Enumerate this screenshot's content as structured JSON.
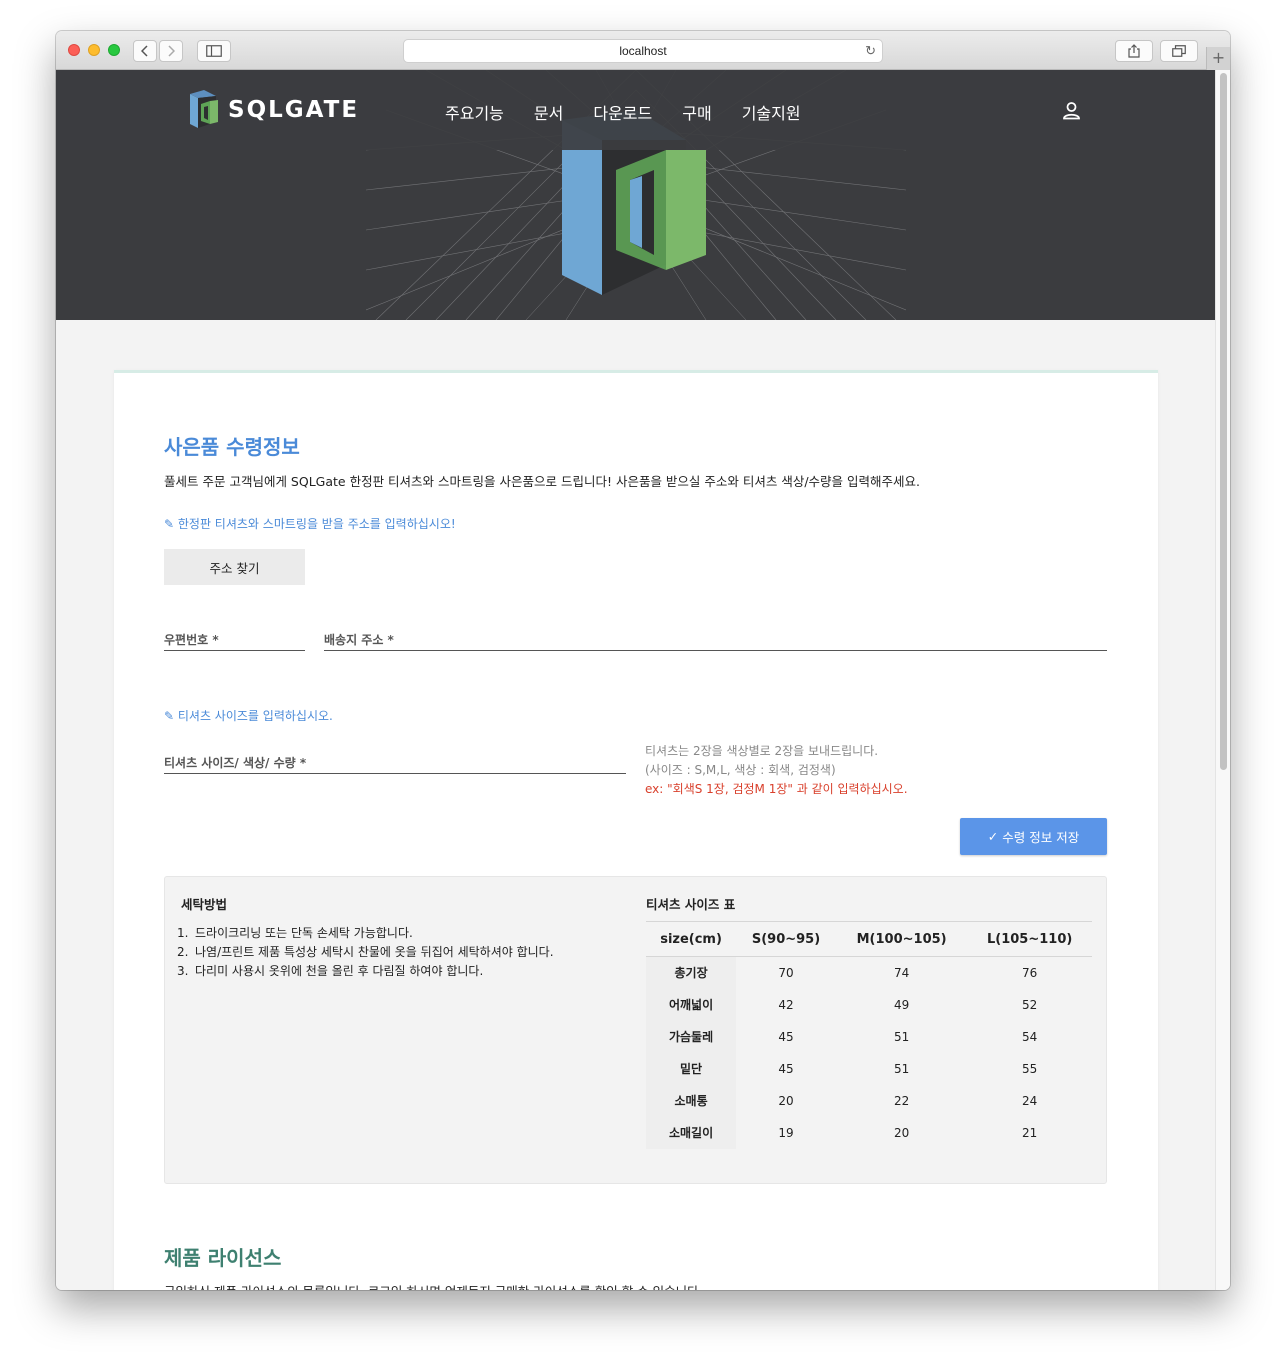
{
  "browser": {
    "url": "localhost"
  },
  "site": {
    "brand": "SQLGATE",
    "nav": [
      "주요기능",
      "문서",
      "다운로드",
      "구매",
      "기술지원"
    ]
  },
  "gift": {
    "title": "사은품 수령정보",
    "description": "풀세트 주문 고객님에게 SQLGate 한정판 티셔츠와 스마트링을 사은품으로 드립니다! 사은품을 받으실 주소와 티셔츠 색상/수량을 입력해주세요.",
    "address_hint": "한정판 티셔츠와 스마트링을 받을 주소를 입력하십시오!",
    "find_address_button": "주소 찾기",
    "postal_code_label": "우편번호 *",
    "address_label": "배송지 주소 *",
    "size_hint": "티셔츠 사이즈를 입력하십시오.",
    "tshirt_label": "티셔츠 사이즈/ 색상/ 수량 *",
    "note_line1": "티셔츠는 2장을 색상별로 2장을 보내드립니다.",
    "note_line2": "(사이즈 : S,M,L, 색상 : 회색, 검정색)",
    "note_example": "ex: \"회색S 1장, 검정M 1장\" 과 같이 입력하십시오.",
    "save_button": "수령 정보 저장"
  },
  "washing": {
    "title": "세탁방법",
    "items": [
      "드라이크리닝 또는 단독 손세탁 가능합니다.",
      "나염/프린트 제품 특성상 세탁시 찬물에 옷을 뒤집어 세탁하셔야 합니다.",
      "다리미 사용시 옷위에 천을 올린 후 다림질 하여야 합니다."
    ]
  },
  "size_chart": {
    "title": "티셔츠 사이즈 표",
    "headers": [
      "size(cm)",
      "S(90~95)",
      "M(100~105)",
      "L(105~110)"
    ],
    "rows": [
      [
        "총기장",
        "70",
        "74",
        "76"
      ],
      [
        "어깨넓이",
        "42",
        "49",
        "52"
      ],
      [
        "가슴둘레",
        "45",
        "51",
        "54"
      ],
      [
        "밑단",
        "45",
        "51",
        "55"
      ],
      [
        "소매통",
        "20",
        "22",
        "24"
      ],
      [
        "소매길이",
        "19",
        "20",
        "21"
      ]
    ]
  },
  "license": {
    "title": "제품 라이선스",
    "description": "구입하신 제품 라이선스의 목록입니다. 로그인 하시면 언제든지 구매한 라이선스를 확인 할 수 있습니다."
  },
  "colors": {
    "accent_blue": "#4a8ad8",
    "save_button": "#5b95e8",
    "license_title": "#3e8070",
    "example_red": "#d9402c",
    "hero_bg": "#3b3c3f"
  }
}
